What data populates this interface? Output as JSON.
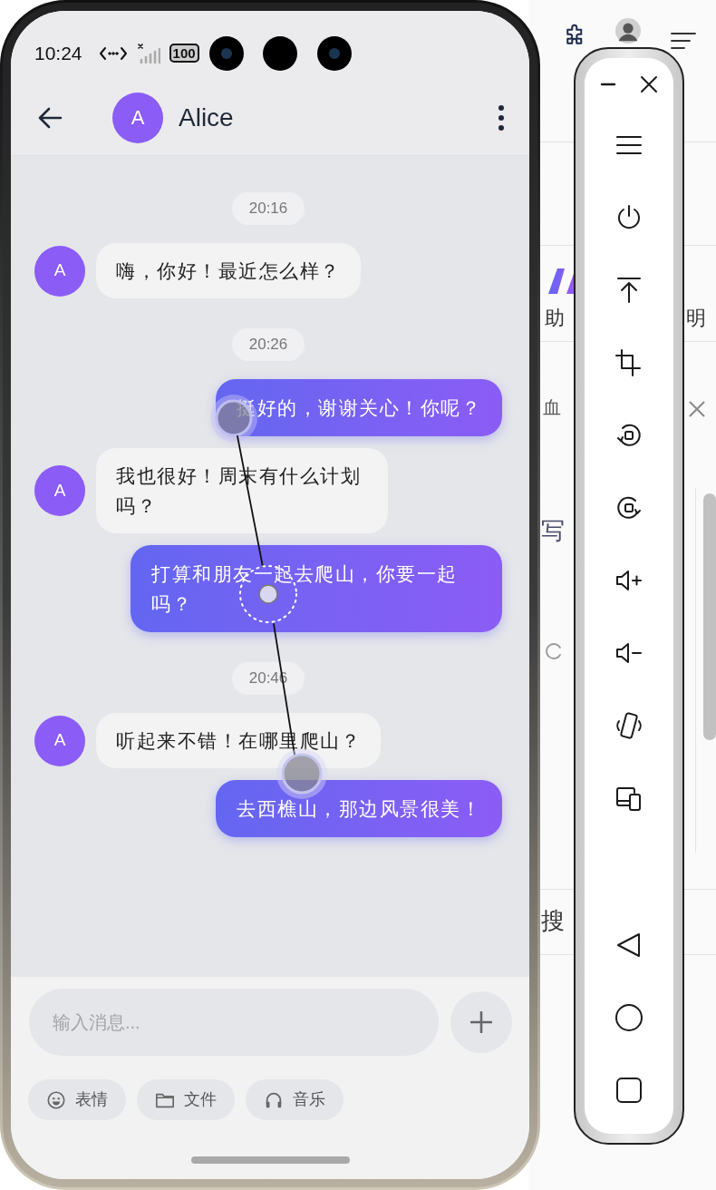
{
  "status_bar": {
    "time": "10:24",
    "battery": "100"
  },
  "header": {
    "avatar_letter": "A",
    "name": "Alice"
  },
  "messages": [
    {
      "kind": "time",
      "text": "20:16"
    },
    {
      "kind": "received",
      "avatar_letter": "A",
      "text": "嗨，你好！最近怎么样？"
    },
    {
      "kind": "time",
      "text": "20:26"
    },
    {
      "kind": "sent",
      "text": "挺好的，谢谢关心！你呢？"
    },
    {
      "kind": "received",
      "avatar_letter": "A",
      "text": "我也很好！周末有什么计划吗？"
    },
    {
      "kind": "sent",
      "text": "打算和朋友一起去爬山，你要一起吗？"
    },
    {
      "kind": "time",
      "text": "20:46"
    },
    {
      "kind": "received",
      "avatar_letter": "A",
      "text": "听起来不错！在哪里爬山？"
    },
    {
      "kind": "sent",
      "text": "去西樵山，那边风景很美！"
    }
  ],
  "composer": {
    "placeholder": "输入消息..."
  },
  "quick_actions": [
    {
      "kind": "emoji",
      "label": "表情"
    },
    {
      "kind": "folder",
      "label": "文件"
    },
    {
      "kind": "headphones",
      "label": "音乐"
    }
  ],
  "background_page": {
    "heading_left": "助",
    "heading_right": "明",
    "banner": "血",
    "section": "写",
    "search_label": "搜"
  }
}
